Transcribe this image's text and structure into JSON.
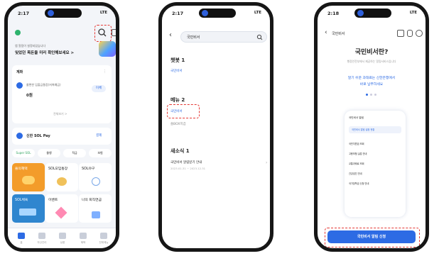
{
  "phone1": {
    "time": "2:17",
    "signal": "LTE",
    "hero_small": "앱 알림이 설정되었습니다",
    "hero_title": "잊었던 목돈을 미리 확인해보세요 >",
    "section_title": "계좌",
    "account_name": "쏠편한 입출금통장(저축예금)",
    "account_amount": "0원",
    "account_button": "이체",
    "more_label": "전체보기 >",
    "pay_label": "신한 SOL Pay",
    "pay_button": "결제",
    "pills": [
      "Super SOL",
      "쏠뱅",
      "적금",
      "보험"
    ],
    "tiles": [
      "쏠의혜택",
      "SOL모임통장",
      "SOL야구",
      "SOL체육",
      "이벤트",
      "나의 퇴직연금"
    ],
    "nav": [
      "홈",
      "자산관리",
      "상품",
      "혜택",
      "전체메뉴"
    ],
    "colors": {
      "orange": "#f39c2a",
      "blue": "#2f86cf",
      "accent": "#2d6be4"
    }
  },
  "phone2": {
    "time": "2:17",
    "signal": "LTE",
    "search_value": "국민비서",
    "section_chatbot": "챗봇 1",
    "chatbot_item": "국민비서",
    "section_menu": "메뉴 2",
    "menu_item1": "국민비서",
    "menu_item2": "쏠BOX지갑",
    "section_news": "새소식 1",
    "news_title": "국민비서 알림받기 안내",
    "news_date": "2023.01.31 ~ 2023.12.31"
  },
  "phone3": {
    "time": "2:18",
    "signal": "LTE",
    "back_label": "국민비서",
    "title": "국민비서란?",
    "desc": "행정안전부에서 제공하는 알림서비스입니다",
    "highlight_line1": "알기 쉬운 과태료는 신한은행에서",
    "highlight_line2": "바로 납부하세요",
    "inner_header": "국민비서 알림",
    "inner_banner": "국민비서 알림 설정 현황",
    "inner_rows": [
      "국민지원금 조회",
      "고용보험 실업 안내",
      "교통과태료 조회",
      "건강검진 안내",
      "국가장학금 신청 안내"
    ],
    "cta_label": "국민비서 알림 신청"
  }
}
